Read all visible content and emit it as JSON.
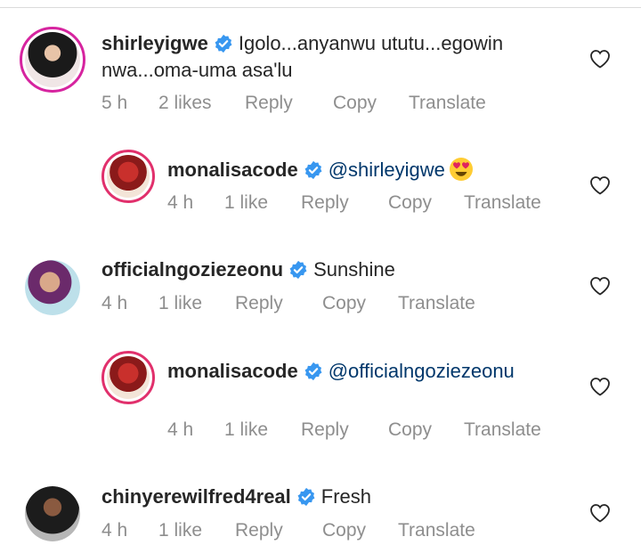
{
  "comments": [
    {
      "username": "shirleyigwe",
      "text": "Igolo...anyanwu ututu...egowin",
      "text_cont": "nwa...oma-uma asa'lu",
      "time": "5 h",
      "likes": "2 likes",
      "reply": "Reply",
      "copy": "Copy",
      "translate": "Translate"
    },
    {
      "username": "monalisacode",
      "mention": "@shirleyigwe",
      "emoji": "heart-eyes-emoji",
      "time": "4 h",
      "likes": "1 like",
      "reply": "Reply",
      "copy": "Copy",
      "translate": "Translate"
    },
    {
      "username": "officialngoziezeonu",
      "text": "Sunshine",
      "time": "4 h",
      "likes": "1 like",
      "reply": "Reply",
      "copy": "Copy",
      "translate": "Translate"
    },
    {
      "username": "monalisacode",
      "mention": "@officialngoziezeonu",
      "time": "4 h",
      "likes": "1 like",
      "reply": "Reply",
      "copy": "Copy",
      "translate": "Translate"
    },
    {
      "username": "chinyerewilfred4real",
      "text": "Fresh",
      "time": "4 h",
      "likes": "1 like",
      "reply": "Reply",
      "copy": "Copy",
      "translate": "Translate"
    }
  ],
  "colors": {
    "verified": "#3897f0",
    "mention": "#00376b",
    "meta": "#8e8e8e",
    "story_ring": "#d6249f"
  }
}
